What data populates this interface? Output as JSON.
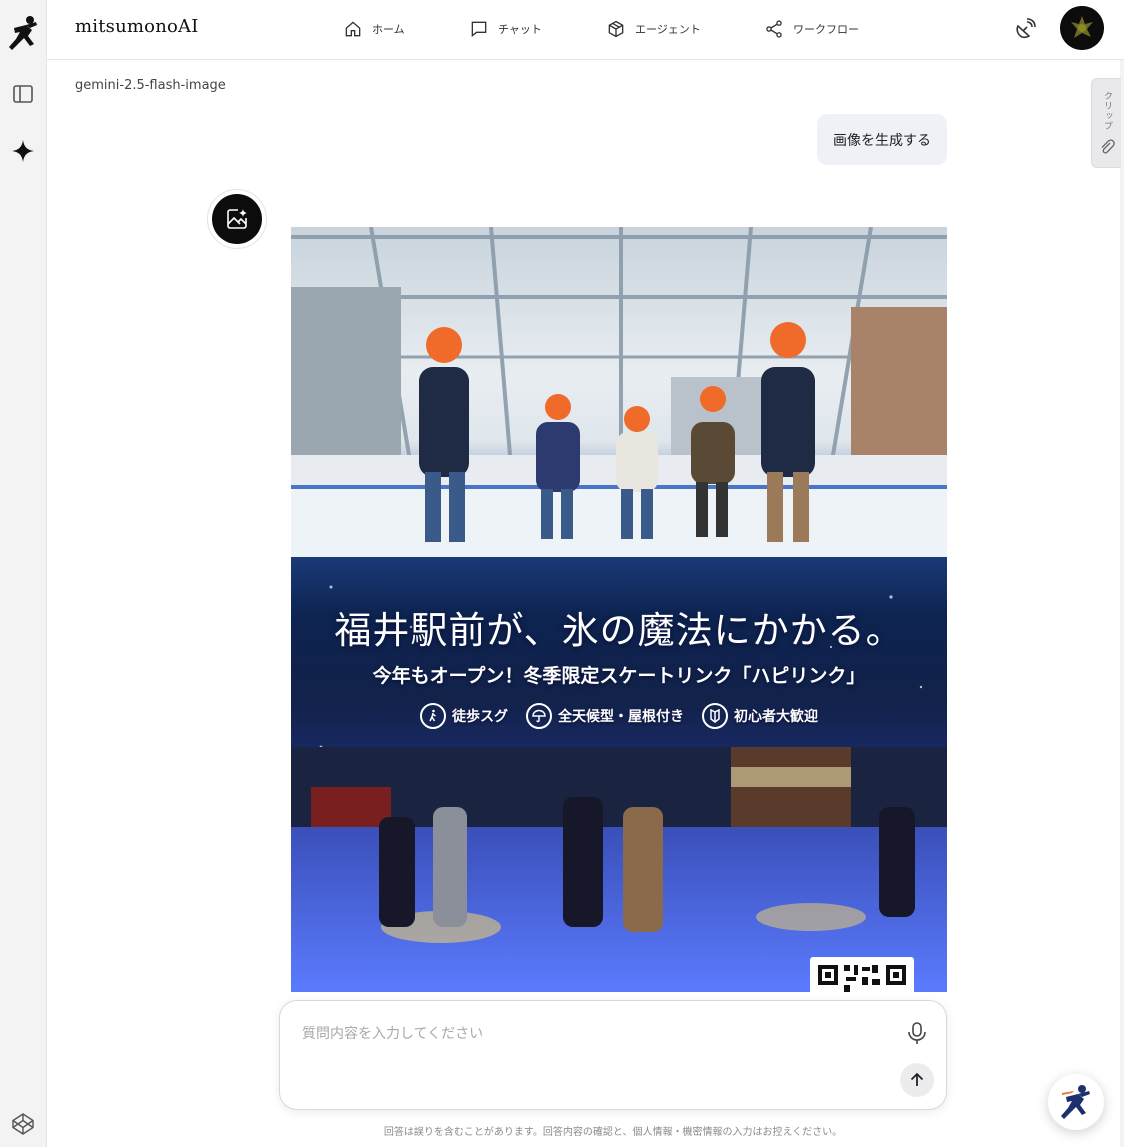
{
  "header": {
    "brand": "mitsumonoAI",
    "nav": [
      {
        "label": "ホーム",
        "icon": "home-icon"
      },
      {
        "label": "チャット",
        "icon": "chat-icon"
      },
      {
        "label": "エージェント",
        "icon": "cube-icon"
      },
      {
        "label": "ワークフロー",
        "icon": "share-nodes-icon"
      }
    ]
  },
  "sidebar": {
    "icons": [
      "runner-logo-icon",
      "sidebar-panel-icon",
      "sparkle-icon",
      "codepen-icon"
    ]
  },
  "clip_tab": {
    "label": "クリップ"
  },
  "chat": {
    "model_name": "gemini-2.5-flash-image",
    "user_message": "画像を生成する",
    "poster": {
      "headline": "福井駅前が、氷の魔法にかかる。",
      "subheadline": "今年もオープン！冬季限定スケートリンク「ハピリンク」",
      "features": [
        "徒歩スグ",
        "全天候型・屋根付き",
        "初心者大歓迎"
      ]
    }
  },
  "composer": {
    "placeholder": "質問内容を入力してください"
  },
  "footer": {
    "disclaimer": "回答は誤りを含むことがあります。回答内容の確認と、個人情報・機密情報の入力はお控えください。"
  },
  "colors": {
    "rail_bg": "#f3f3f4",
    "bubble_bg": "#eef1f6",
    "poster_night": "#0a1f4d"
  }
}
